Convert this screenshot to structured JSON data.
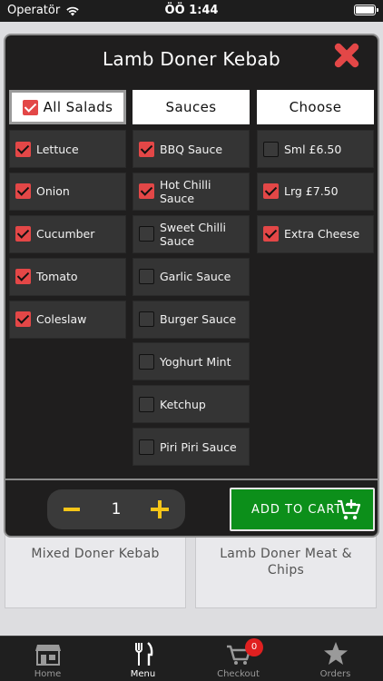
{
  "status_bar": {
    "carrier": "Operatör",
    "time": "ÖÖ 1:44"
  },
  "background": {
    "products": [
      {
        "name": "Mixed Doner Kebab"
      },
      {
        "name": "Lamb Doner Meat & Chips"
      }
    ]
  },
  "modal": {
    "title": "Lamb Doner Kebab",
    "columns": [
      {
        "header": "All Salads",
        "header_checked": true,
        "options": [
          {
            "label": "Lettuce",
            "checked": true
          },
          {
            "label": "Onion",
            "checked": true
          },
          {
            "label": "Cucumber",
            "checked": true
          },
          {
            "label": "Tomato",
            "checked": true
          },
          {
            "label": "Coleslaw",
            "checked": true
          }
        ]
      },
      {
        "header": "Sauces",
        "options": [
          {
            "label": "BBQ Sauce",
            "checked": true
          },
          {
            "label": "Hot Chilli Sauce",
            "checked": true
          },
          {
            "label": "Sweet Chilli Sauce",
            "checked": false
          },
          {
            "label": "Garlic Sauce",
            "checked": false
          },
          {
            "label": "Burger Sauce",
            "checked": false
          },
          {
            "label": "Yoghurt Mint",
            "checked": false
          },
          {
            "label": "Ketchup",
            "checked": false
          },
          {
            "label": "Piri Piri Sauce",
            "checked": false
          }
        ]
      },
      {
        "header": "Choose",
        "options": [
          {
            "label": "Sml £6.50",
            "checked": false
          },
          {
            "label": "Lrg £7.50",
            "checked": true
          },
          {
            "label": "Extra Cheese",
            "checked": true
          }
        ]
      }
    ],
    "quantity": "1",
    "add_to_cart_label": "ADD TO CART"
  },
  "tabbar": {
    "tabs": [
      {
        "label": "Home",
        "icon": "store-icon"
      },
      {
        "label": "Menu",
        "icon": "fork-knife-icon",
        "active": true
      },
      {
        "label": "Checkout",
        "icon": "cart-icon",
        "badge": "0"
      },
      {
        "label": "Orders",
        "icon": "star-icon"
      }
    ]
  },
  "colors": {
    "accent_red": "#e34747",
    "cart_green": "#0c8f1a",
    "qty_yellow": "#f5c518"
  }
}
